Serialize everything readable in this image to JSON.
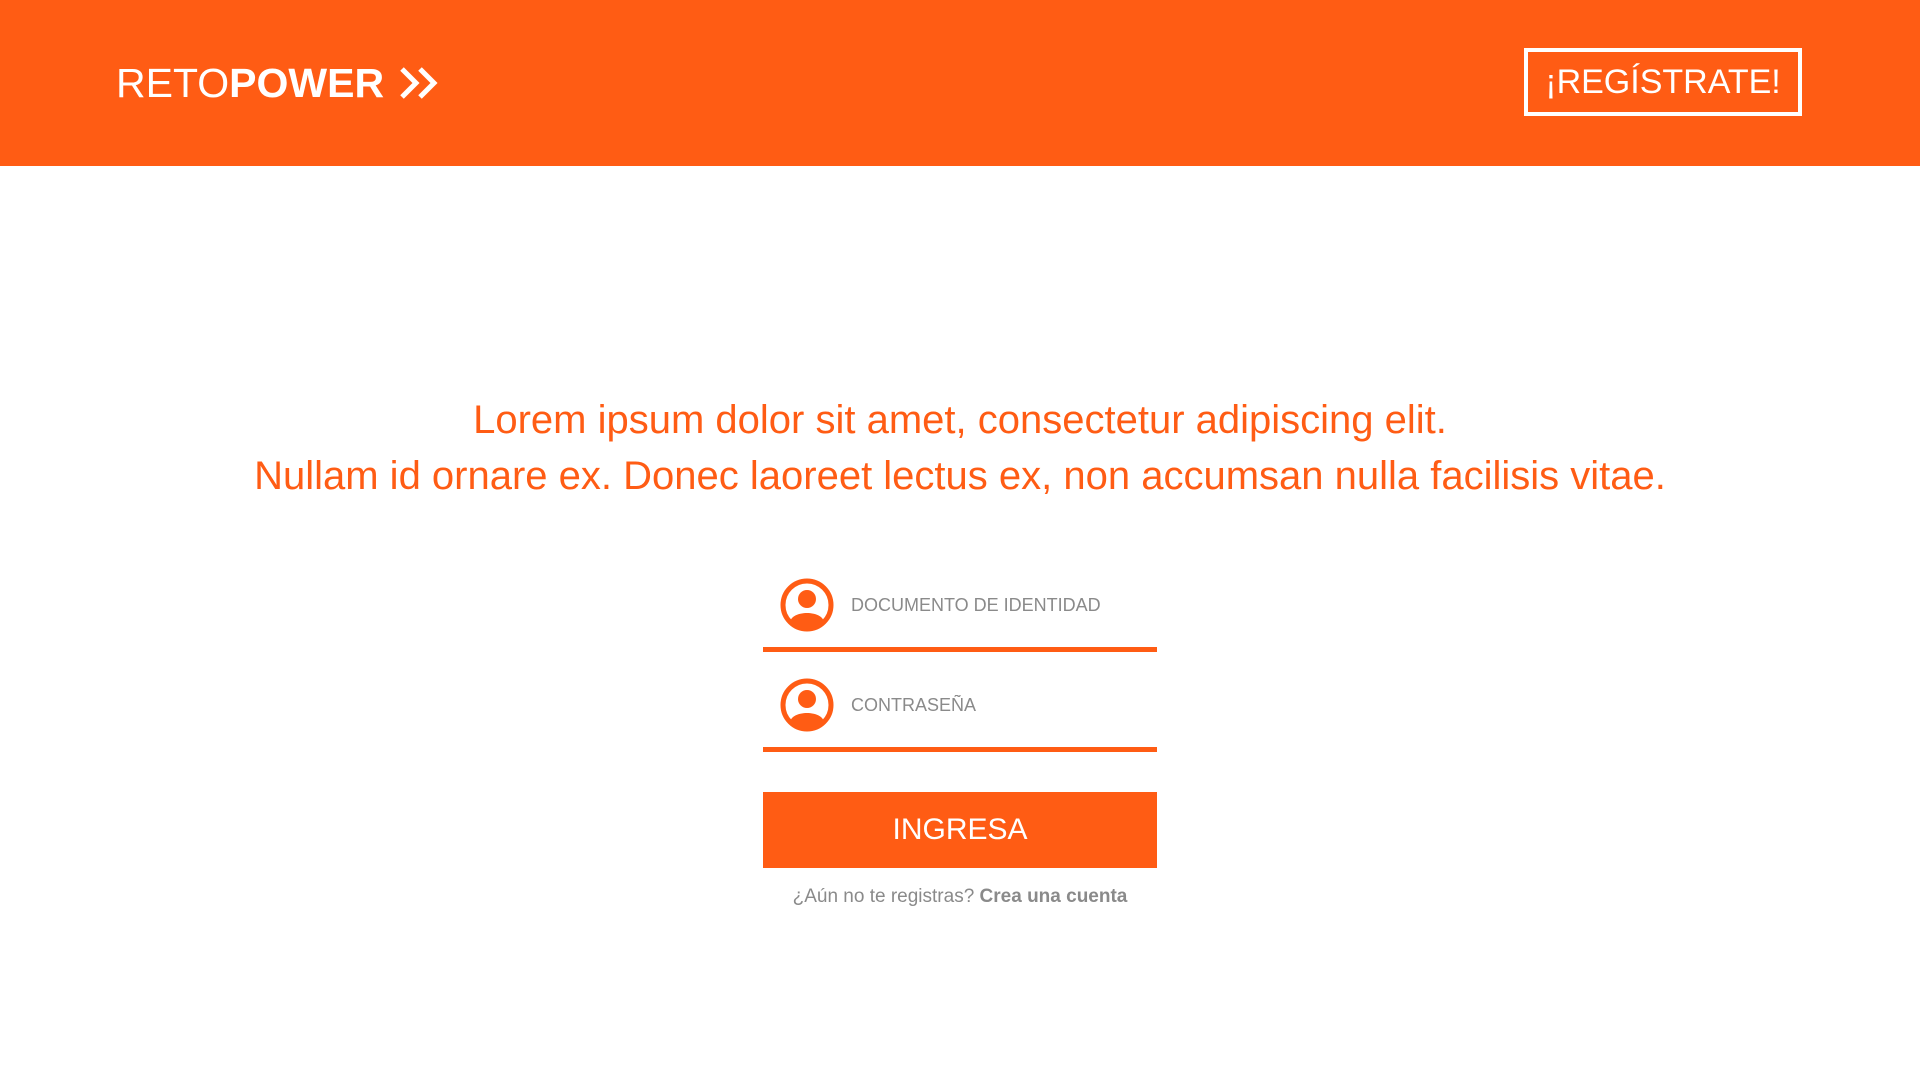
{
  "header": {
    "logo_light": "RETO",
    "logo_bold": "POWER",
    "logo_icon": "double-chevron-right-icon",
    "register_label": "¡REGÍSTRATE!",
    "background_color": "#ff5c14"
  },
  "main": {
    "tagline_line1": "Lorem ipsum dolor sit amet, consectetur adipiscing elit.",
    "tagline_line2": "Nullam id ornare ex. Donec laoreet lectus ex, non accumsan nulla facilisis vitae.",
    "accent_color": "#ff5c14"
  },
  "login_form": {
    "document_field": {
      "icon": "user-icon",
      "placeholder": "DOCUMENTO DE IDENTIDAD",
      "value": ""
    },
    "password_field": {
      "icon": "user-icon",
      "placeholder": "CONTRASEÑA",
      "value": ""
    },
    "submit_label": "INGRESA",
    "signup_prompt": "¿Aún no te registras?",
    "signup_link": "Crea una cuenta"
  }
}
